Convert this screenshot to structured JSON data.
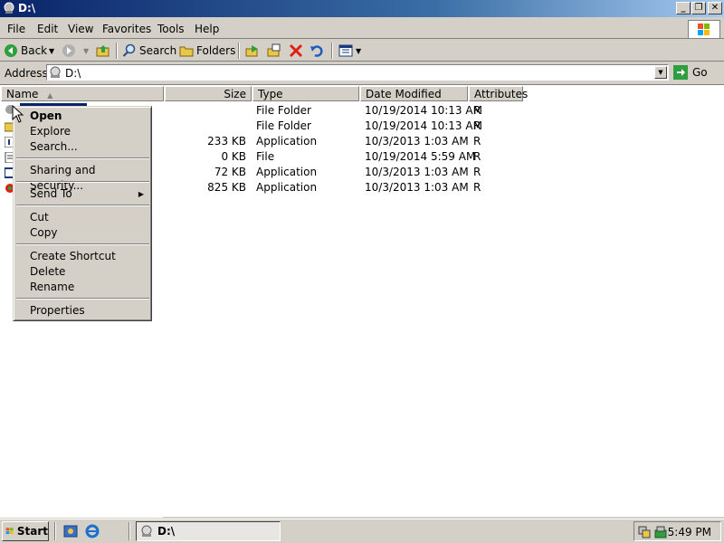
{
  "window": {
    "title": "D:\\"
  },
  "menu": [
    "File",
    "Edit",
    "View",
    "Favorites",
    "Tools",
    "Help"
  ],
  "toolbar": {
    "back_label": "Back",
    "search_label": "Search",
    "folders_label": "Folders"
  },
  "address": {
    "label": "Address",
    "value": "D:\\",
    "go_label": "Go"
  },
  "columns": [
    "Name",
    "Size",
    "Type",
    "Date Modified",
    "Attributes"
  ],
  "files": [
    {
      "size": "",
      "type": "File Folder",
      "date": "10/19/2014 10:13 AM",
      "attr": "R"
    },
    {
      "size": "",
      "type": "File Folder",
      "date": "10/19/2014 10:13 AM",
      "attr": "R"
    },
    {
      "size": "233 KB",
      "type": "Application",
      "date": "10/3/2013 1:03 AM",
      "attr": "R"
    },
    {
      "size": "0 KB",
      "type": "File",
      "date": "10/19/2014 5:59 AM",
      "attr": "R"
    },
    {
      "size": "72 KB",
      "type": "Application",
      "date": "10/3/2013 1:03 AM",
      "attr": "R"
    },
    {
      "size": "825 KB",
      "type": "Application",
      "date": "10/3/2013 1:03 AM",
      "attr": "R"
    }
  ],
  "context_menu": {
    "open": "Open",
    "explore": "Explore",
    "search": "Search...",
    "sharing": "Sharing and Security...",
    "send_to": "Send To",
    "cut": "Cut",
    "copy": "Copy",
    "create_shortcut": "Create Shortcut",
    "delete": "Delete",
    "rename": "Rename",
    "properties": "Properties"
  },
  "taskbar": {
    "start_label": "Start",
    "task_label": "D:\\",
    "clock": "5:49 PM"
  }
}
